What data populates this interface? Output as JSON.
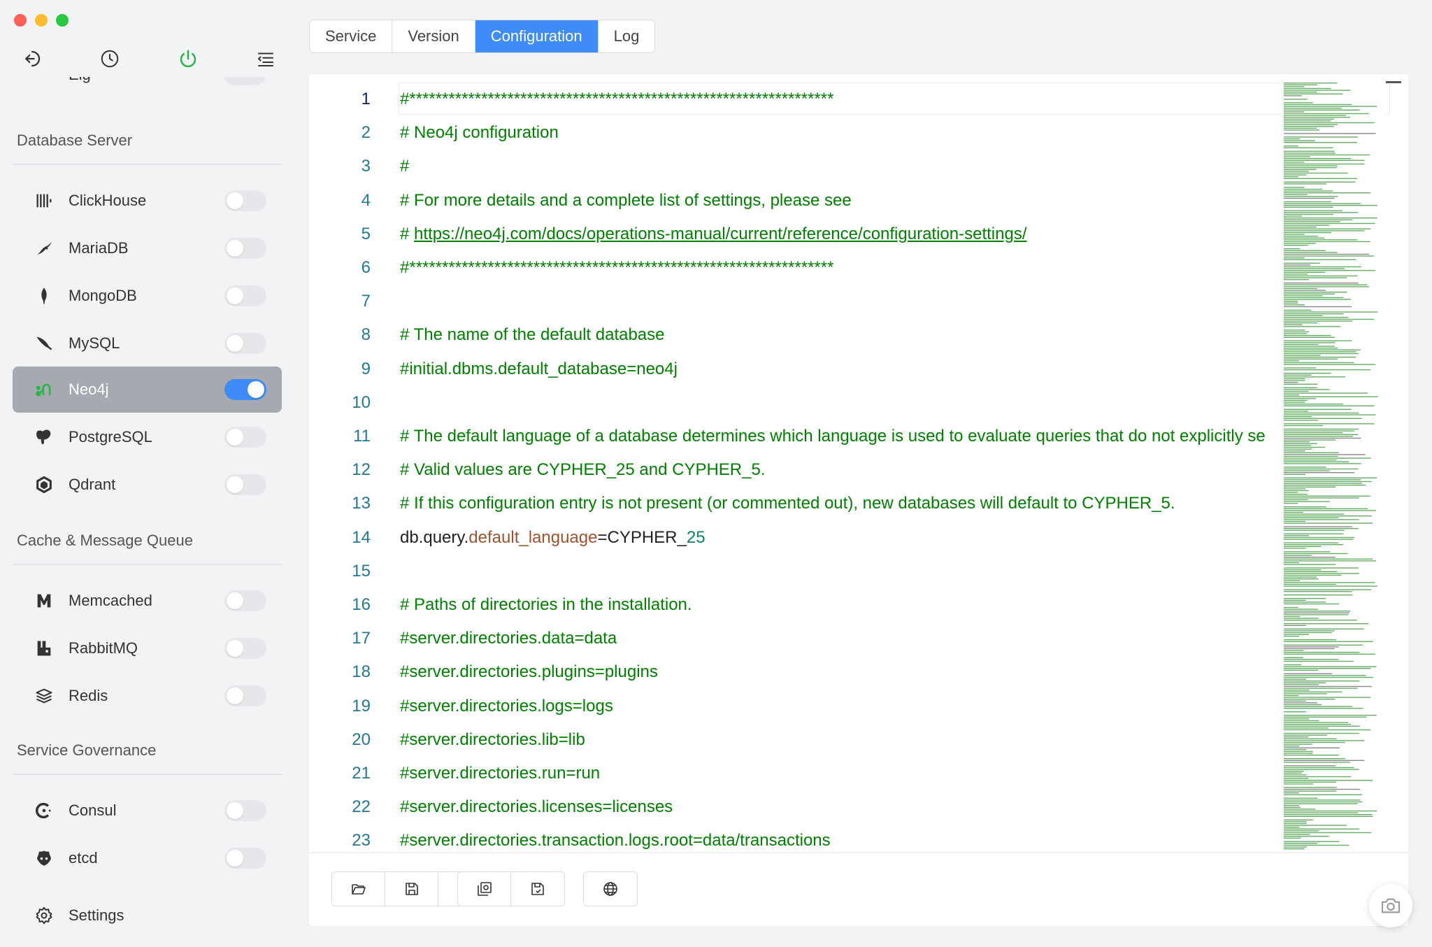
{
  "window": {
    "controls": [
      "close",
      "minimize",
      "zoom"
    ]
  },
  "toolbar_icons": [
    "back-icon",
    "history-icon",
    "power-icon",
    "menu-icon"
  ],
  "sidebar": {
    "partial_item": {
      "label": "Elg",
      "icon": "elg-icon"
    },
    "sections": [
      {
        "title": "Database Server",
        "items": [
          {
            "label": "ClickHouse",
            "icon": "clickhouse-icon",
            "enabled": false
          },
          {
            "label": "MariaDB",
            "icon": "mariadb-icon",
            "enabled": false
          },
          {
            "label": "MongoDB",
            "icon": "mongodb-icon",
            "enabled": false
          },
          {
            "label": "MySQL",
            "icon": "mysql-icon",
            "enabled": false
          },
          {
            "label": "Neo4j",
            "icon": "neo4j-icon",
            "enabled": true,
            "active": true
          },
          {
            "label": "PostgreSQL",
            "icon": "postgresql-icon",
            "enabled": false
          },
          {
            "label": "Qdrant",
            "icon": "qdrant-icon",
            "enabled": false
          }
        ]
      },
      {
        "title": "Cache & Message Queue",
        "items": [
          {
            "label": "Memcached",
            "icon": "memcached-icon",
            "enabled": false
          },
          {
            "label": "RabbitMQ",
            "icon": "rabbitmq-icon",
            "enabled": false
          },
          {
            "label": "Redis",
            "icon": "redis-icon",
            "enabled": false
          }
        ]
      },
      {
        "title": "Service Governance",
        "items": [
          {
            "label": "Consul",
            "icon": "consul-icon",
            "enabled": false
          },
          {
            "label": "etcd",
            "icon": "etcd-icon",
            "enabled": false
          }
        ]
      }
    ],
    "settings_label": "Settings"
  },
  "tabs": [
    {
      "label": "Service",
      "active": false
    },
    {
      "label": "Version",
      "active": false
    },
    {
      "label": "Configuration",
      "active": true
    },
    {
      "label": "Log",
      "active": false
    }
  ],
  "editor": {
    "lines": [
      {
        "n": "1",
        "text": "#*****************************************************************"
      },
      {
        "n": "2",
        "text": "# Neo4j configuration"
      },
      {
        "n": "3",
        "text": "#"
      },
      {
        "n": "4",
        "text": "# For more details and a complete list of settings, please see"
      },
      {
        "n": "5",
        "text": "# ",
        "url": "https://neo4j.com/docs/operations-manual/current/reference/configuration-settings/"
      },
      {
        "n": "6",
        "text": "#*****************************************************************"
      },
      {
        "n": "7",
        "text": ""
      },
      {
        "n": "8",
        "text": "# The name of the default database"
      },
      {
        "n": "9",
        "text": "#initial.dbms.default_database=neo4j"
      },
      {
        "n": "10",
        "text": ""
      },
      {
        "n": "11",
        "text": "# The default language of a database determines which language is used to evaluate queries that do not explicitly se"
      },
      {
        "n": "12",
        "text": "# Valid values are CYPHER_25 and CYPHER_5."
      },
      {
        "n": "13",
        "text": "# If this configuration entry is not present (or commented out), new databases will default to CYPHER_5."
      },
      {
        "n": "14",
        "parts": [
          "db.query.",
          "default_language",
          "=CYPHER_",
          "25"
        ]
      },
      {
        "n": "15",
        "text": ""
      },
      {
        "n": "16",
        "text": "# Paths of directories in the installation."
      },
      {
        "n": "17",
        "text": "#server.directories.data=data"
      },
      {
        "n": "18",
        "text": "#server.directories.plugins=plugins"
      },
      {
        "n": "19",
        "text": "#server.directories.logs=logs"
      },
      {
        "n": "20",
        "text": "#server.directories.lib=lib"
      },
      {
        "n": "21",
        "text": "#server.directories.run=run"
      },
      {
        "n": "22",
        "text": "#server.directories.licenses=licenses"
      },
      {
        "n": "23",
        "text": "#server.directories.transaction.logs.root=data/transactions"
      }
    ],
    "current_line": "1"
  },
  "footer_buttons": {
    "group1": [
      "open-folder-icon",
      "save-icon",
      "reload-icon"
    ],
    "group2": [
      "load-default-icon",
      "save-as-default-icon"
    ],
    "group3": [
      "globe-icon"
    ]
  },
  "colors": {
    "accent": "#3e8cf7",
    "active_item_bg": "#a6a9af",
    "comment": "#008000",
    "line_number": "#237893",
    "keyword_orange": "#a0522d",
    "number_teal": "#098658"
  }
}
